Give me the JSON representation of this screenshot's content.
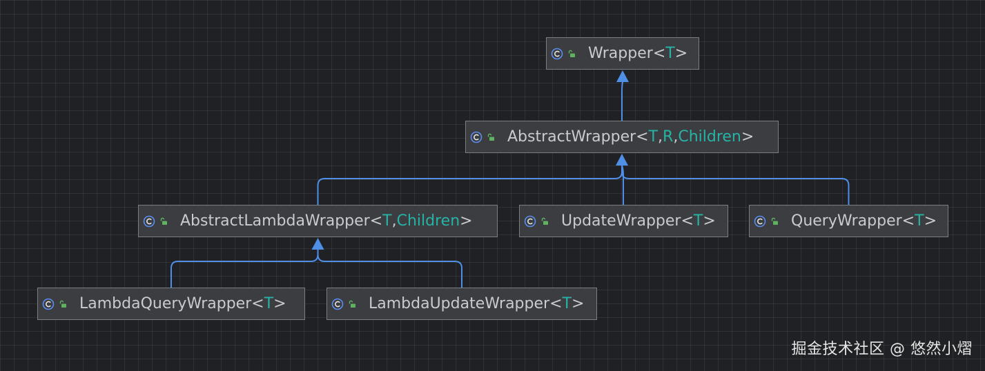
{
  "nodes": [
    {
      "id": "wrapper",
      "name": "Wrapper",
      "params": [
        "T"
      ]
    },
    {
      "id": "abstract-wrapper",
      "name": "AbstractWrapper",
      "params": [
        "T",
        "R",
        "Children"
      ]
    },
    {
      "id": "abstract-lambda-wrapper",
      "name": "AbstractLambdaWrapper",
      "params": [
        "T",
        "Children"
      ]
    },
    {
      "id": "update-wrapper",
      "name": "UpdateWrapper",
      "params": [
        "T"
      ]
    },
    {
      "id": "query-wrapper",
      "name": "QueryWrapper",
      "params": [
        "T"
      ]
    },
    {
      "id": "lambda-query-wrapper",
      "name": "LambdaQueryWrapper",
      "params": [
        "T"
      ]
    },
    {
      "id": "lambda-update-wrapper",
      "name": "LambdaUpdateWrapper",
      "params": [
        "T"
      ]
    }
  ],
  "edges": [
    {
      "from": "abstract-wrapper",
      "to": "wrapper"
    },
    {
      "from": "abstract-lambda-wrapper",
      "to": "abstract-wrapper"
    },
    {
      "from": "update-wrapper",
      "to": "abstract-wrapper"
    },
    {
      "from": "query-wrapper",
      "to": "abstract-wrapper"
    },
    {
      "from": "lambda-query-wrapper",
      "to": "abstract-lambda-wrapper"
    },
    {
      "from": "lambda-update-wrapper",
      "to": "abstract-lambda-wrapper"
    }
  ],
  "icons": {
    "class": "class-c-icon",
    "visibility": "public-lock-icon"
  },
  "colors": {
    "background": "#1f2125",
    "node_fill": "#3b3d41",
    "node_border": "#7b7e84",
    "text": "#c9cbcf",
    "type_param": "#27b3a6",
    "arrow": "#4f8fe6",
    "icon_blue": "#5b8def",
    "icon_green": "#5fb360"
  },
  "watermark": "掘金技术社区 @ 悠然小熠"
}
